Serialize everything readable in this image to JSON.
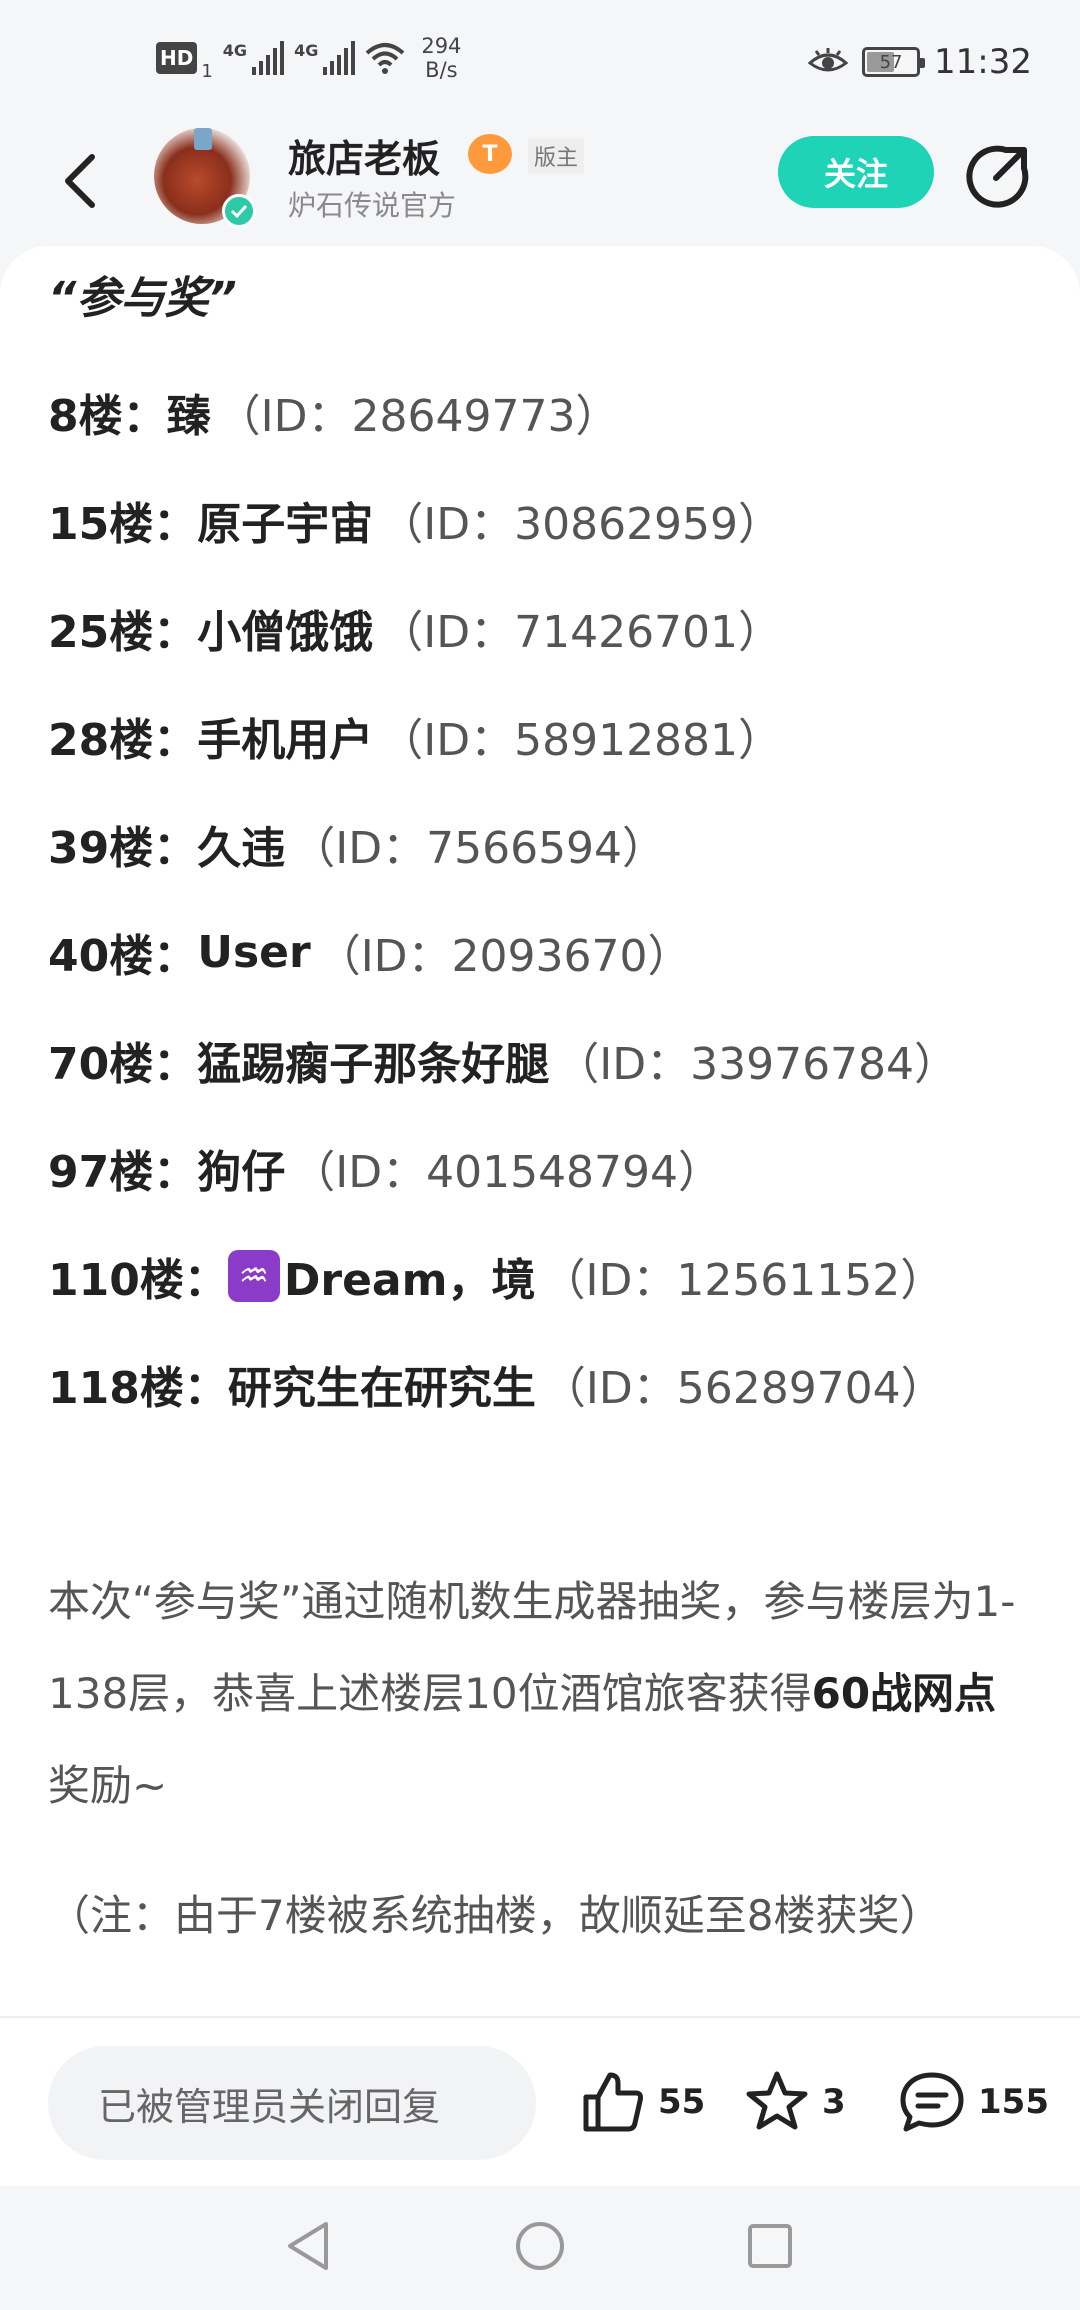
{
  "status_bar": {
    "hd_label": "HD",
    "sim_number": "1",
    "net1": "4G",
    "net2": "4G",
    "speed_value": "294",
    "speed_unit": "B/s",
    "battery": "57",
    "battery_level_percent": 57,
    "time": "11:32"
  },
  "header": {
    "author_name": "旅店老板",
    "level_badge": "T",
    "role_badge": "版主",
    "author_sub": "炉石传说官方",
    "follow_label": "关注"
  },
  "post": {
    "heading": "“参与奖”",
    "winners": [
      {
        "floor": "8楼：",
        "name": "臻",
        "uid": "（ID：28649773）"
      },
      {
        "floor": "15楼：",
        "name": "原子宇宙",
        "uid": "（ID：30862959）"
      },
      {
        "floor": "25楼：",
        "name": "小僧饿饿",
        "uid": "（ID：71426701）"
      },
      {
        "floor": "28楼：",
        "name": "手机用户",
        "uid": "（ID：58912881）"
      },
      {
        "floor": "39楼：",
        "name": "久违",
        "uid": "（ID：7566594）"
      },
      {
        "floor": "40楼：",
        "name": "User",
        "uid": "（ID：2093670）"
      },
      {
        "floor": "70楼：",
        "name": "猛踢瘸子那条好腿",
        "uid": "（ID：33976784）"
      },
      {
        "floor": "97楼：",
        "name": "狗仔",
        "uid": "（ID：401548794）"
      },
      {
        "floor": "110楼：",
        "name": "Dream，境",
        "uid": "（ID：12561152）"
      },
      {
        "floor": "118楼：",
        "name": "研究生在研究生",
        "uid": "（ID：56289704）"
      }
    ],
    "para1_pre": "本次“参与奖”通过随机数生成器抽奖，参与楼层为1-138层，恭喜上述楼层10位酒馆旅客获得",
    "para1_bold": "60战网点",
    "para1_post": "奖励~",
    "para2": "（注：由于7楼被系统抽楼，故顺延至8楼获奖）"
  },
  "bottom_bar": {
    "reply_placeholder": "已被管理员关闭回复",
    "like_count": "55",
    "favorite_count": "3",
    "comment_count": "155"
  },
  "colors": {
    "accent": "#1fd3b6",
    "badge": "#ff9a3c",
    "zodiac": "#8a3cc8"
  }
}
